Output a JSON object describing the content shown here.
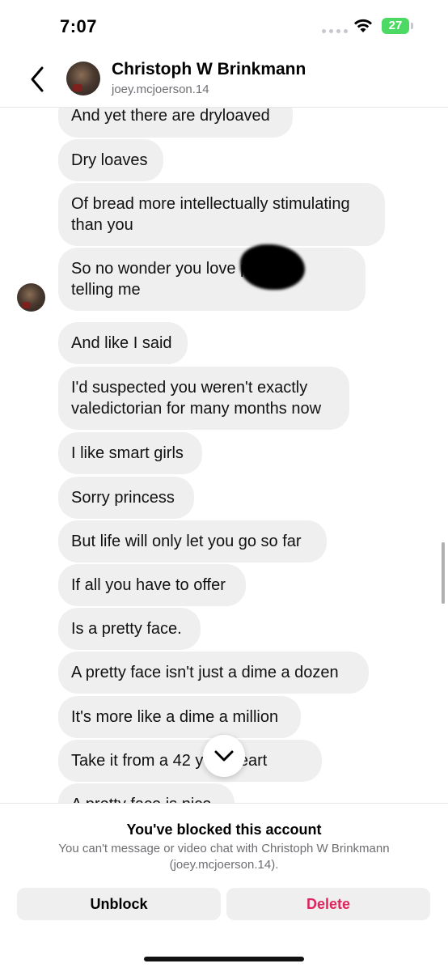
{
  "status_bar": {
    "time": "7:07",
    "battery": "27"
  },
  "header": {
    "name": "Christoph W Brinkmann",
    "username": "joey.mcjoerson.14"
  },
  "messages": [
    {
      "text": "And yet there are dryloaved"
    },
    {
      "text": "Dry loaves"
    },
    {
      "text": "Of bread more intellectually stimulating\nthan you"
    },
    {
      "text": "So no wonder you love      p. Ty for\ntelling me"
    },
    {
      "text": "And like I said"
    },
    {
      "text": "I'd suspected you weren't exactly\nvaledictorian for many months now"
    },
    {
      "text": "I like smart girls"
    },
    {
      "text": "Sorry princess"
    },
    {
      "text": "But life will only let you go so far"
    },
    {
      "text": "If all you have to offer"
    },
    {
      "text": "Is a pretty face."
    },
    {
      "text": "A pretty face isn't just a dime a dozen"
    },
    {
      "text": "It's more like a dime a million"
    },
    {
      "text": "Take it from a 42 y      eetheart"
    },
    {
      "text": "A pretty face is nice"
    }
  ],
  "blocked_panel": {
    "title": "You've blocked this account",
    "description": "You can't message or video chat with Christoph W Brinkmann (joey.mcjoerson.14).",
    "unblock_label": "Unblock",
    "delete_label": "Delete"
  },
  "colors": {
    "bubble": "#efefef",
    "delete": "#e0245e",
    "battery": "#4cd964"
  },
  "icons": [
    "back-chevron-icon",
    "wifi-icon",
    "battery-icon",
    "chevron-down-icon"
  ]
}
